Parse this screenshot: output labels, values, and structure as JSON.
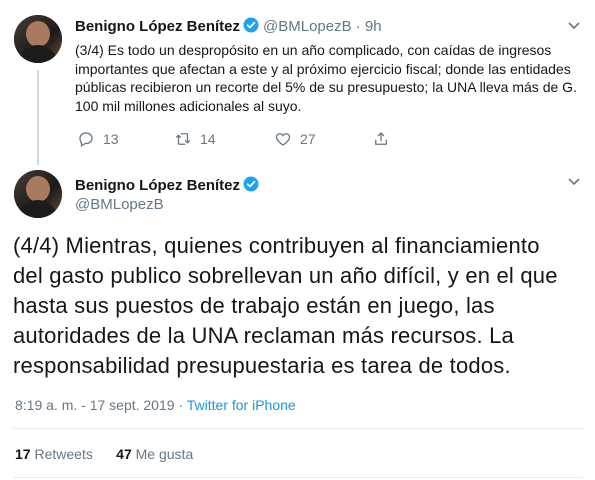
{
  "reply_tweet": {
    "author_name": "Benigno López Benítez",
    "handle": "@BMLopezB",
    "separator": "·",
    "time": "9h",
    "text": "(3/4) Es todo un despropósito en un año complicado, con caídas de ingresos importantes que afectan a este y al próximo ejercicio fiscal; donde las entidades públicas recibieron un recorte del 5% de su presupuesto; la UNA lleva más de G. 100 mil millones adicionales al suyo.",
    "reply_count": "13",
    "retweet_count": "14",
    "like_count": "27"
  },
  "main_tweet": {
    "author_name": "Benigno López Benítez",
    "handle": "@BMLopezB",
    "text": "(4/4) Mientras, quienes contribuyen al financiamiento del gasto publico sobrellevan un año difícil, y en el que hasta sus puestos de trabajo están en juego, las autoridades de la UNA reclaman más recursos. La responsabilidad presupuestaria es tarea de todos.",
    "timestamp": "8:19 a. m. - 17 sept. 2019",
    "meta_separator": "·",
    "source": "Twitter for iPhone",
    "retweets_count": "17",
    "retweets_label": "Retweets",
    "likes_count": "47",
    "likes_label": "Me gusta"
  },
  "colors": {
    "text": "#14171a",
    "secondary": "#657786",
    "link": "#1b95e0",
    "verified": "#1da1f2",
    "divider": "#e6ecf0"
  },
  "icons": [
    "verified-badge-icon",
    "chevron-down-icon",
    "reply-icon",
    "retweet-icon",
    "like-icon",
    "share-icon"
  ]
}
